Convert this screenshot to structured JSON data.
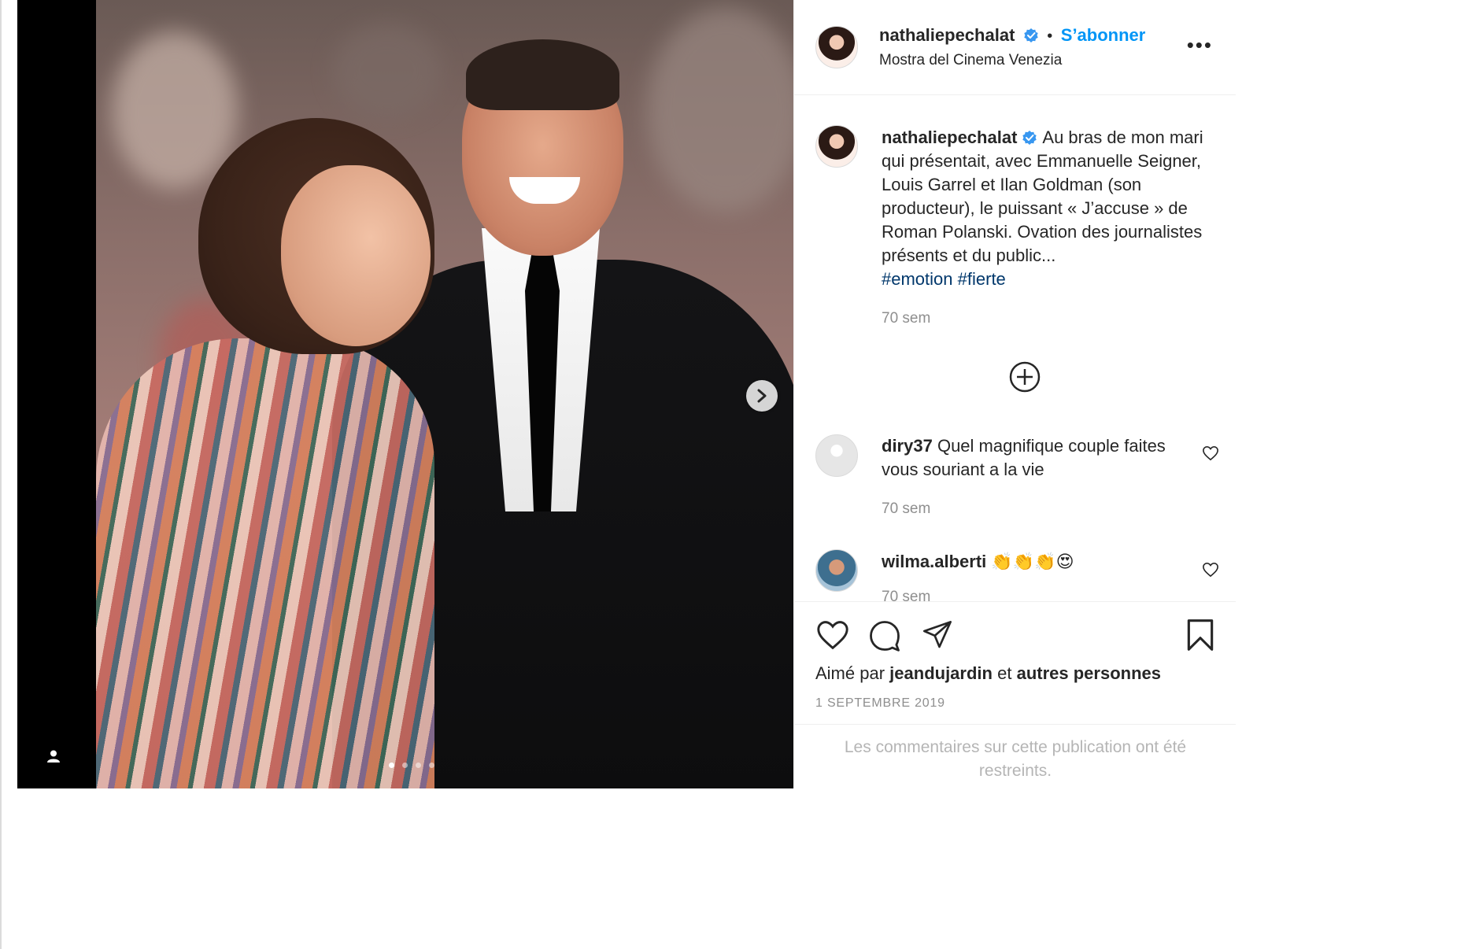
{
  "post": {
    "username": "nathaliepechalat",
    "follow_label": "S’abonner",
    "separator": "•",
    "location": "Mostra del Cinema Venezia",
    "more_glyph": "•••",
    "caption": {
      "username": "nathaliepechalat",
      "text": "Au bras de mon mari qui présentait, avec Emmanuelle Seigner, Louis Garrel et Ilan Goldman (son producteur), le puissant « J’accuse » de Roman Polanski. Ovation des journalistes présents et du public...",
      "hashtags": [
        "#emotion",
        "#fierte"
      ],
      "time": "70 sem"
    },
    "load_more_glyph": "⊕",
    "comments": [
      {
        "username": "diry37",
        "text": "Quel magnifique couple faites vous souriant a la vie",
        "time": "70 sem"
      },
      {
        "username": "wilma.alberti",
        "text": "👏👏👏😍",
        "time": "70 sem"
      }
    ],
    "liked_by": {
      "prefix": "Aimé par",
      "user": "jeandujardin",
      "conj": "et",
      "others": "autres personnes"
    },
    "date": "1 SEPTEMBRE 2019",
    "restricted_notice": "Les commentaires sur cette publication ont été restreints.",
    "carousel": {
      "count": 4,
      "active": 1
    },
    "colors": {
      "accent": "#0095f6",
      "hashtag": "#00376b",
      "muted": "#8e8e8e",
      "verified": "#3897f0"
    }
  }
}
